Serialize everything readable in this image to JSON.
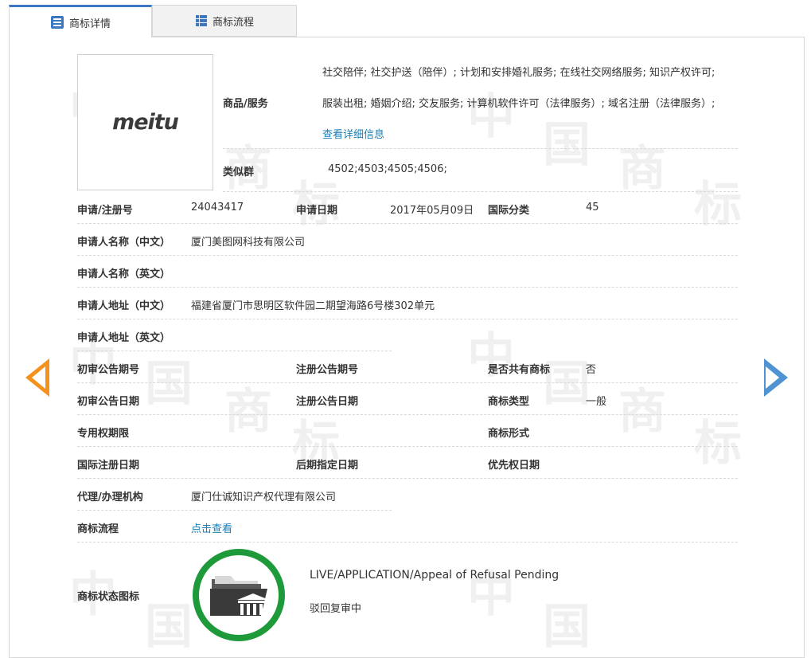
{
  "tabs": {
    "detail": "商标详情",
    "flow": "商标流程"
  },
  "logo": {
    "text": "meitu"
  },
  "goods": {
    "label": "商品/服务",
    "line1": "社交陪伴; 社交护送（陪伴）; 计划和安排婚礼服务; 在线社交网络服务; 知识产权许可;",
    "line2": "服装出租; 婚姻介绍; 交友服务; 计算机软件许可（法律服务）; 域名注册（法律服务）;",
    "more_link": "查看详细信息"
  },
  "similar": {
    "label": "类似群",
    "value": "4502;4503;4505;4506;"
  },
  "fields": {
    "reg_no_label": "申请/注册号",
    "reg_no": "24043417",
    "app_date_label": "申请日期",
    "app_date": "2017年05月09日",
    "intl_class_label": "国际分类",
    "intl_class": "45",
    "applicant_cn_label": "申请人名称（中文）",
    "applicant_cn": "厦门美图网科技有限公司",
    "applicant_en_label": "申请人名称（英文）",
    "address_cn_label": "申请人地址（中文）",
    "address_cn": "福建省厦门市思明区软件园二期望海路6号楼302单元",
    "address_en_label": "申请人地址（英文）",
    "prelim_no_label": "初审公告期号",
    "reg_pub_no_label": "注册公告期号",
    "shared_label": "是否共有商标",
    "shared": "否",
    "prelim_date_label": "初审公告日期",
    "reg_pub_date_label": "注册公告日期",
    "tm_type_label": "商标类型",
    "tm_type": "一般",
    "exclusive_label": "专用权期限",
    "tm_form_label": "商标形式",
    "intl_reg_date_label": "国际注册日期",
    "later_date_label": "后期指定日期",
    "priority_label": "优先权日期",
    "agent_label": "代理/办理机构",
    "agent": "厦门仕诚知识产权代理有限公司",
    "flow_label": "商标流程",
    "flow_link": "点击查看",
    "status_label": "商标状态图标"
  },
  "status": {
    "en": "LIVE/APPLICATION/Appeal of Refusal Pending",
    "cn": "驳回复审中"
  },
  "watermark": [
    "中",
    "国",
    "商",
    "标"
  ],
  "colors": {
    "accent_blue": "#3b78c4",
    "link": "#1a7fb5",
    "arrow_left": "#f5921e",
    "arrow_right": "#4f93d2",
    "status_ring": "#1e9a3b"
  }
}
